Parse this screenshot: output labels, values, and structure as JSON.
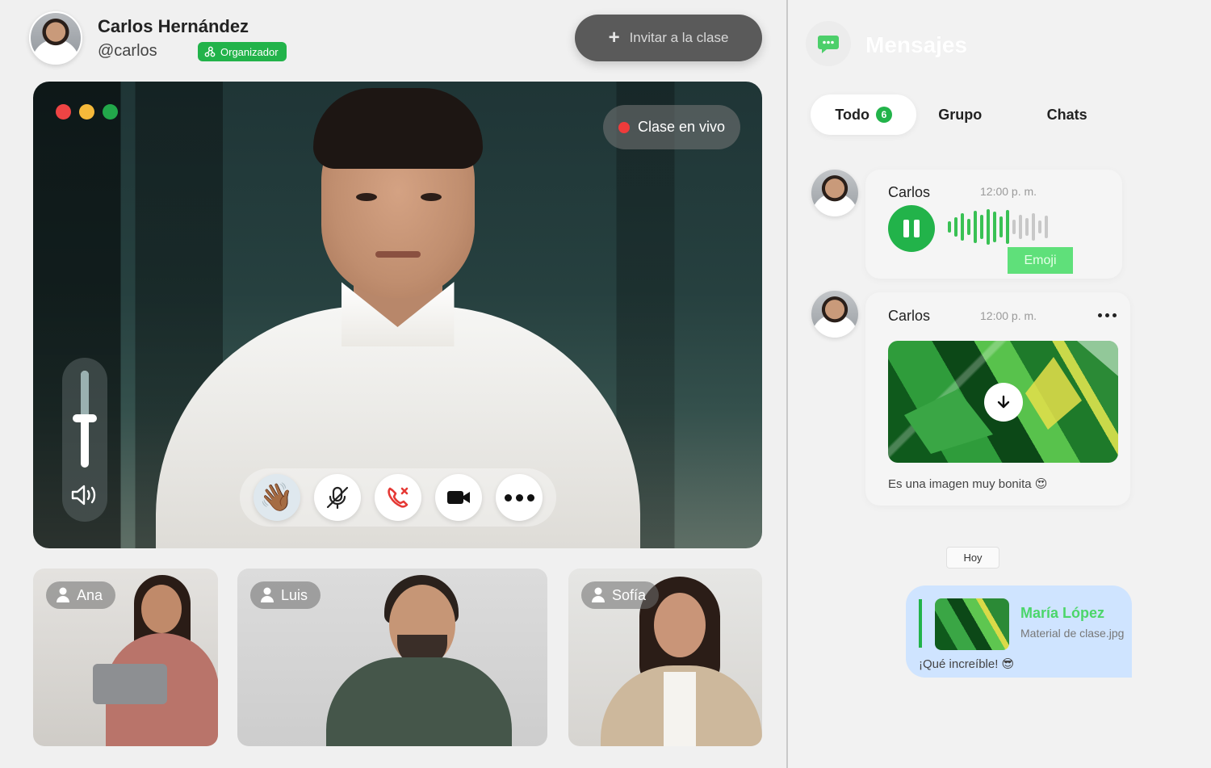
{
  "host": {
    "name": "Carlos Hernández",
    "handle": "@carlos",
    "role": "Organizador"
  },
  "header": {
    "invite_label": "Invitar a la clase"
  },
  "main_video": {
    "live_label": "Clase en vivo",
    "volume_level": 0.45
  },
  "participants": [
    {
      "name": "Ana"
    },
    {
      "name": "Luis"
    },
    {
      "name": "Sofía"
    }
  ],
  "messages_panel": {
    "title": "Mensajes",
    "tabs": [
      {
        "label": "Todo",
        "count": "6"
      },
      {
        "label": "Grupo"
      },
      {
        "label": "Chats"
      }
    ],
    "items": [
      {
        "sender": "Carlos",
        "time": "12:00 p. m.",
        "type": "voice",
        "tag": "Emoji"
      },
      {
        "sender": "Carlos",
        "time": "12:00 p. m.",
        "type": "image",
        "caption": "Es una imagen muy bonita 😍"
      }
    ],
    "day_separator": "Hoy",
    "reply": {
      "name": "María López",
      "file": "Material de clase.jpg",
      "text": "¡Qué increíble! 😎"
    }
  },
  "colors": {
    "accent_green": "#22b34a",
    "live_red": "#ef3b3b",
    "reply_bubble": "#cfe4ff"
  }
}
